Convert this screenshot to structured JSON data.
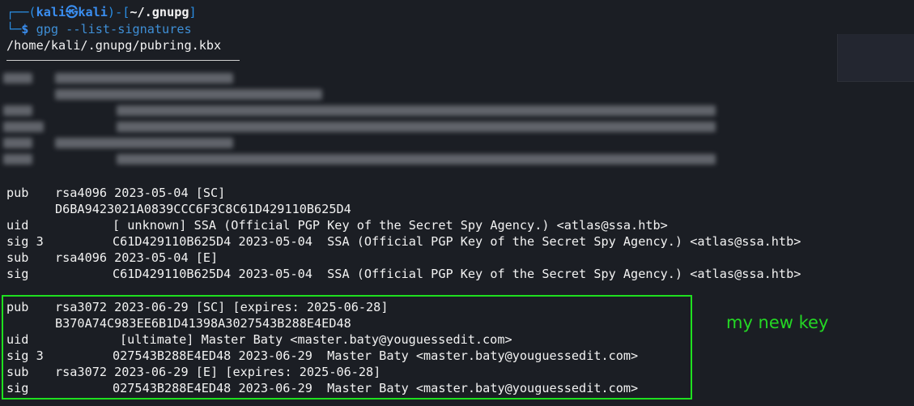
{
  "prompt": {
    "frame_top": "┌──(",
    "user_host": "kali㉿kali",
    "bracket_mid": ")-[",
    "path": "~/.gnupg",
    "bracket_end": "]",
    "frame_bottom": "└─",
    "dollar": "$",
    "command": "gpg --list-signatures"
  },
  "keyring_path": "/home/kali/.gnupg/pubring.kbx",
  "keys": [
    {
      "lines": [
        {
          "tag": "pub",
          "text": "rsa4096 2023-05-04 [SC]"
        },
        {
          "tag": "",
          "text": "D6BA9423021A0839CCC6F3C8C61D429110B625D4"
        },
        {
          "tag": "uid",
          "text": "[ unknown] SSA (Official PGP Key of the Secret Spy Agency.) <atlas@ssa.htb>"
        },
        {
          "tag": "sig 3",
          "text": "C61D429110B625D4 2023-05-04  SSA (Official PGP Key of the Secret Spy Agency.) <atlas@ssa.htb>"
        },
        {
          "tag": "sub",
          "text": "rsa4096 2023-05-04 [E]"
        },
        {
          "tag": "sig",
          "text": "C61D429110B625D4 2023-05-04  SSA (Official PGP Key of the Secret Spy Agency.) <atlas@ssa.htb>"
        }
      ]
    },
    {
      "lines": [
        {
          "tag": "pub",
          "text": "rsa3072 2023-06-29 [SC] [expires: 2025-06-28]"
        },
        {
          "tag": "",
          "text": "B370A74C983EE6B1D41398A3027543B288E4ED48"
        },
        {
          "tag": "uid",
          "text": "[ultimate] Master Baty <master.baty@youguessedit.com>"
        },
        {
          "tag": "sig 3",
          "text": "027543B288E4ED48 2023-06-29  Master Baty <master.baty@youguessedit.com>"
        },
        {
          "tag": "sub",
          "text": "rsa3072 2023-06-29 [E] [expires: 2025-06-28]"
        },
        {
          "tag": "sig",
          "text": "027543B288E4ED48 2023-06-29  Master Baty <master.baty@youguessedit.com>"
        }
      ]
    }
  ],
  "annotation": "my new key",
  "colors": {
    "background": "#1b1e24",
    "prompt_blue": "#3a8ef0",
    "command_blue": "#3f8fd6",
    "highlight_green": "#1fe01f",
    "text": "#f2f2f2"
  }
}
